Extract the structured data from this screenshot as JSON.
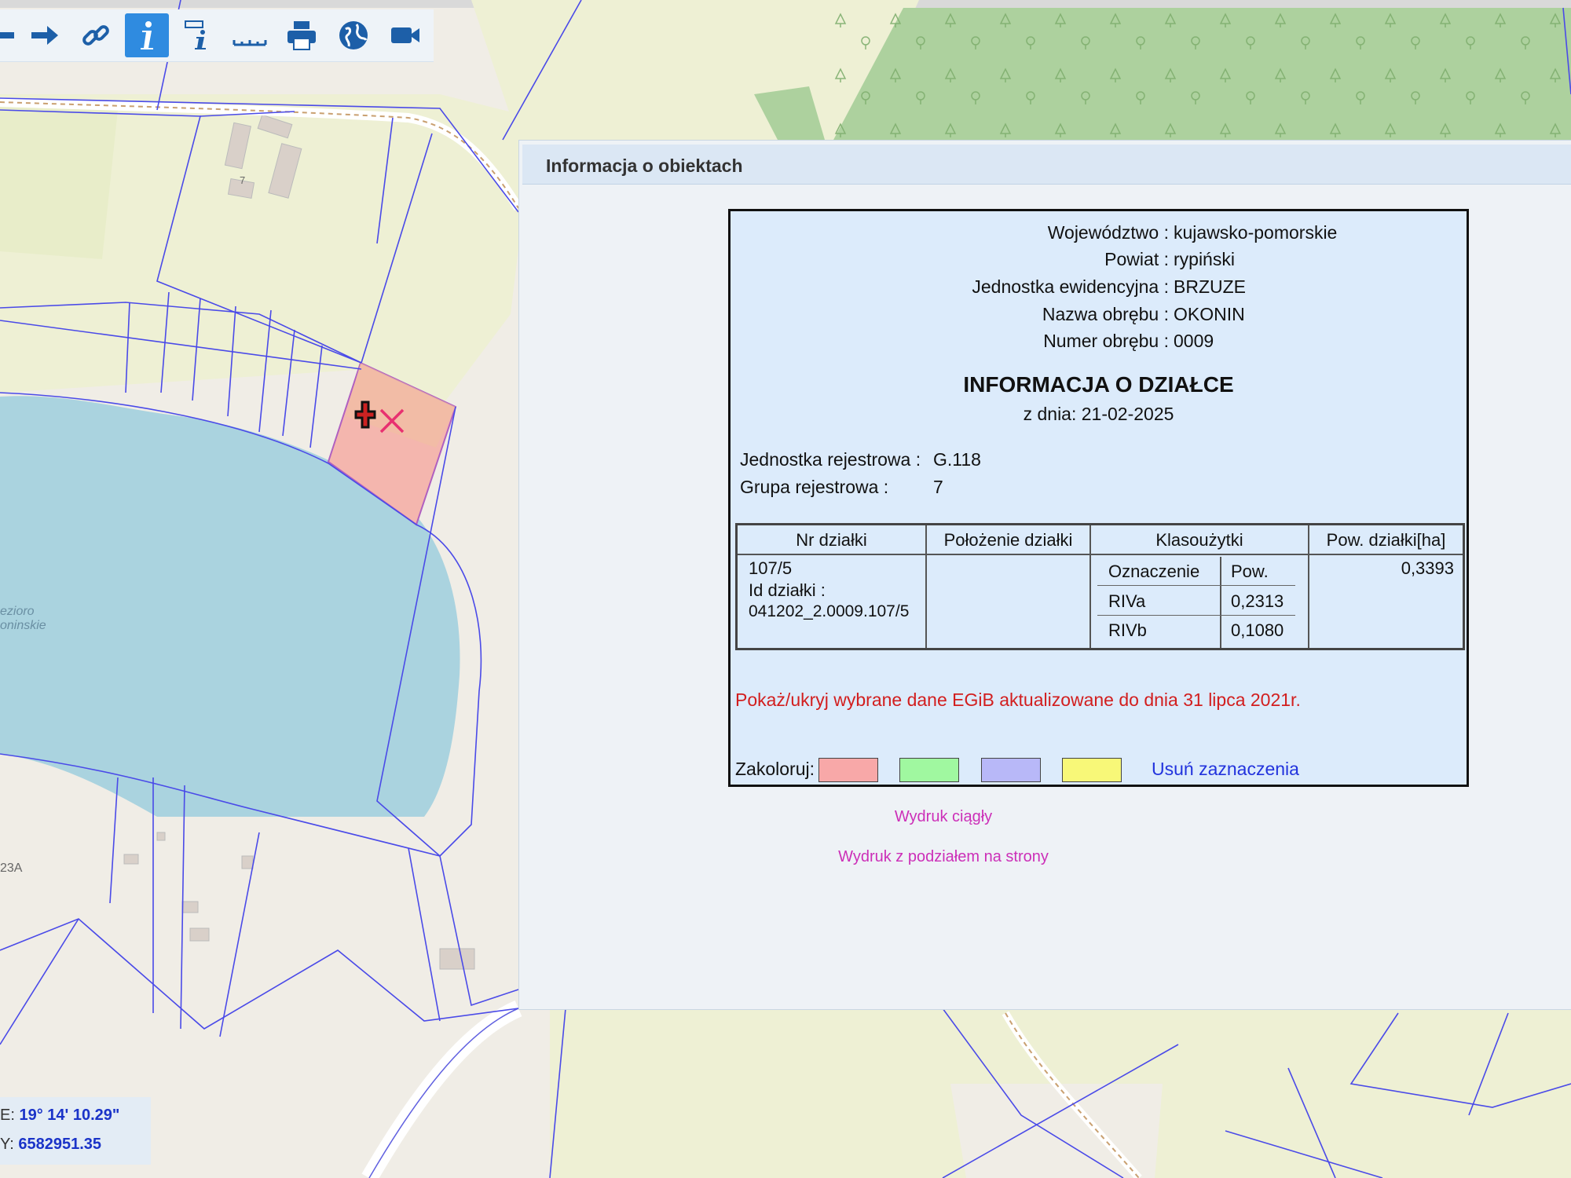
{
  "toolbar": {
    "buttons": [
      {
        "name": "back-arrow-icon",
        "active": false
      },
      {
        "name": "forward-arrow-icon",
        "active": false
      },
      {
        "name": "link-icon",
        "active": false
      },
      {
        "name": "info-icon",
        "active": true
      },
      {
        "name": "info-select-icon",
        "active": false
      },
      {
        "name": "measure-icon",
        "active": false
      },
      {
        "name": "print-icon",
        "active": false
      },
      {
        "name": "globe-icon",
        "active": false
      },
      {
        "name": "video-camera-icon",
        "active": false
      }
    ]
  },
  "map": {
    "lake_label_line1": "ezioro",
    "lake_label_line2": "oninskie",
    "address_label": "23A",
    "building_label": "7",
    "selected_parcel_color": "#f4b6ae",
    "water_color": "#aad3df",
    "parcel_line_color": "#4a4ae8",
    "forest_color": "#add19e"
  },
  "coordinates": {
    "e_label": "E:",
    "e_value": "19° 14' 10.29\"",
    "y_label": "Y:",
    "y_value": "6582951.35"
  },
  "dialog": {
    "title": "Informacja o obiektach",
    "admin": {
      "wojewodztwo_label": "Województwo :",
      "wojewodztwo_value": "kujawsko-pomorskie",
      "powiat_label": "Powiat :",
      "powiat_value": "rypiński",
      "jednostka_label": "Jednostka ewidencyjna :",
      "jednostka_value": "BRZUZE",
      "obreb_nazwa_label": "Nazwa obrębu :",
      "obreb_nazwa_value": "OKONIN",
      "obreb_numer_label": "Numer obrębu :",
      "obreb_numer_value": "0009"
    },
    "heading": "INFORMACJA O DZIAŁCE",
    "date_line": "z dnia: 21-02-2025",
    "jednostka_rej_label": "Jednostka rejestrowa :",
    "jednostka_rej_value": "G.118",
    "grupa_rej_label": "Grupa rejestrowa :",
    "grupa_rej_value": "7",
    "table": {
      "headers": [
        "Nr działki",
        "Położenie działki",
        "Klasoużytki",
        "Pow. działki[ha]"
      ],
      "nr_dzialki": "107/5",
      "id_label": "Id działki :",
      "id_value": "041202_2.0009.107/5",
      "polozenie": "",
      "klasouzytki_headers": [
        "Oznaczenie",
        "Pow."
      ],
      "klasouzytki": [
        {
          "oznaczenie": "RIVa",
          "pow": "0,2313"
        },
        {
          "oznaczenie": "RIVb",
          "pow": "0,1080"
        }
      ],
      "pow_dzialki": "0,3393"
    },
    "egib_link": "Pokaż/ukryj wybrane dane EGiB aktualizowane do dnia 31 lipca 2021r.",
    "zakoloruj_label": "Zakoloruj:",
    "swatch_colors": [
      "#f8a8a8",
      "#a0f8a0",
      "#b8b8f8",
      "#f8f878"
    ],
    "usun_label": "Usuń zaznaczenia",
    "print_continuous": "Wydruk ciągły",
    "print_pages": "Wydruk z podziałem na strony"
  }
}
